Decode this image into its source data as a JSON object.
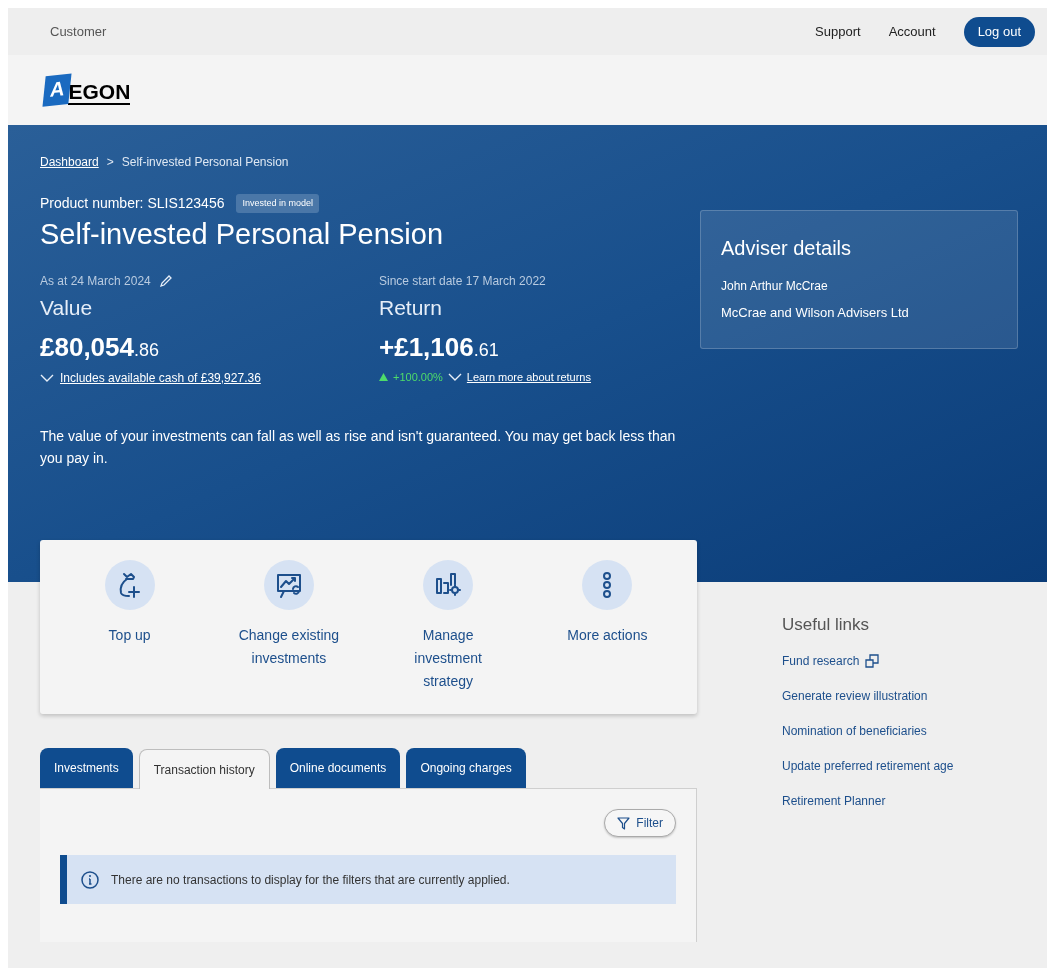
{
  "top_bar": {
    "section": "Customer",
    "links": [
      "Support",
      "Account"
    ],
    "logout": "Log out"
  },
  "logo": {
    "letter": "A",
    "wordmark": "EGON"
  },
  "breadcrumb": {
    "parent": "Dashboard",
    "separator": ">",
    "current": "Self-invested Personal Pension"
  },
  "product": {
    "number": "Product number: SLIS123456",
    "badge": "Invested in model",
    "title": "Self-invested Personal Pension"
  },
  "value": {
    "date": "As at 24 March 2024",
    "label": "Value",
    "amount": "£80,054",
    "decimals": ".86",
    "details_link": "Includes available cash of £39,927.36"
  },
  "return": {
    "date": "Since start date 17 March 2022",
    "label": "Return",
    "amount": "+£1,106",
    "decimals": ".61",
    "change": "+100.00%",
    "details_link": "Learn more about returns"
  },
  "disclaimer": "The value of your investments can fall as well as rise and isn't guaranteed. You may get back less than you pay in.",
  "adviser": {
    "title": "Adviser details",
    "name": "John Arthur McCrae",
    "company": "McCrae and Wilson Advisers Ltd"
  },
  "actions": [
    {
      "label": "Top up",
      "kind": "topup"
    },
    {
      "label": "Change existing investments",
      "kind": "change"
    },
    {
      "label": "Manage investment strategy",
      "kind": "strategy"
    },
    {
      "label": "More actions",
      "kind": "more"
    }
  ],
  "tabs": [
    {
      "label": "Investments",
      "selected": false
    },
    {
      "label": "Transaction history",
      "selected": true
    },
    {
      "label": "Online documents",
      "selected": false
    },
    {
      "label": "Ongoing charges",
      "selected": false
    }
  ],
  "filter_button": "Filter",
  "notice": "There are no transactions to display for the filters that are currently applied.",
  "useful_links": {
    "title": "Useful links",
    "items": [
      {
        "label": "Fund research",
        "external": true
      },
      {
        "label": "Generate review illustration",
        "external": false
      },
      {
        "label": "Nomination of beneficiaries",
        "external": false
      },
      {
        "label": "Update preferred retirement age",
        "external": false
      },
      {
        "label": "Retirement Planner",
        "external": false
      }
    ]
  }
}
